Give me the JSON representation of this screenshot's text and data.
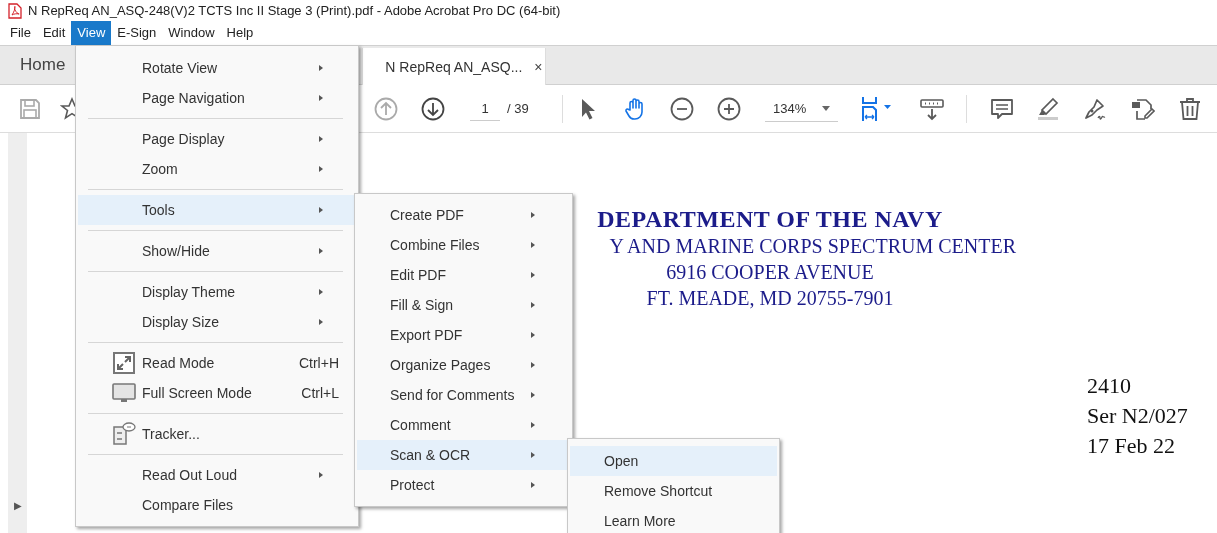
{
  "window": {
    "title": "N RepReq AN_ASQ-248(V)2 TCTS Inc II Stage 3 (Print).pdf - Adobe Acrobat Pro DC (64-bit)"
  },
  "menu_bar": [
    {
      "label": "File",
      "selected": false
    },
    {
      "label": "Edit",
      "selected": false
    },
    {
      "label": "View",
      "selected": true
    },
    {
      "label": "E-Sign",
      "selected": false
    },
    {
      "label": "Window",
      "selected": false
    },
    {
      "label": "Help",
      "selected": false
    }
  ],
  "tabs": [
    {
      "label": "Home",
      "selected": false
    },
    {
      "label": "N RepReq AN_ASQ...",
      "selected": true,
      "close": "×"
    }
  ],
  "toolbar": {
    "page": "1",
    "page_count": "/ 39",
    "zoom": "134%",
    "tools": [
      {
        "selected": false
      },
      {
        "selected": true
      }
    ]
  },
  "document": {
    "heading": "DEPARTMENT OF THE NAVY",
    "address": [
      "Y AND MARINE CORPS SPECTRUM CENTER",
      "6916 COOPER AVENUE",
      "FT. MEADE, MD 20755-7901"
    ],
    "reference": [
      "2410",
      "Ser N2/027",
      "17 Feb 22"
    ],
    "expander": "▶"
  },
  "view_menu": {
    "groups": [
      [
        {
          "label": "Rotate View",
          "submenu": true,
          "selected": false
        },
        {
          "label": "Page Navigation",
          "submenu": true,
          "selected": false
        }
      ],
      [
        {
          "label": "Page Display",
          "submenu": true,
          "selected": false
        },
        {
          "label": "Zoom",
          "submenu": true,
          "selected": false
        }
      ],
      [
        {
          "label": "Tools",
          "submenu": true,
          "selected": true
        }
      ],
      [
        {
          "label": "Show/Hide",
          "submenu": true,
          "selected": false
        }
      ],
      [
        {
          "label": "Display Theme",
          "submenu": true,
          "selected": false
        },
        {
          "label": "Display Size",
          "submenu": true,
          "selected": false
        }
      ],
      [
        {
          "label": "Read Mode",
          "shortcut": "Ctrl+H",
          "submenu": false,
          "selected": false
        },
        {
          "label": "Full Screen Mode",
          "shortcut": "Ctrl+L",
          "submenu": false,
          "selected": false
        }
      ],
      [
        {
          "label": "Tracker...",
          "submenu": false,
          "selected": false
        }
      ],
      [
        {
          "label": "Read Out Loud",
          "submenu": true,
          "selected": false
        },
        {
          "label": "Compare Files",
          "submenu": false,
          "selected": false
        }
      ]
    ]
  },
  "tools_menu": {
    "items": [
      {
        "label": "Create PDF",
        "submenu": true,
        "selected": false
      },
      {
        "label": "Combine Files",
        "submenu": true,
        "selected": false
      },
      {
        "label": "Edit PDF",
        "submenu": true,
        "selected": false
      },
      {
        "label": "Fill & Sign",
        "submenu": true,
        "selected": false
      },
      {
        "label": "Export PDF",
        "submenu": true,
        "selected": false
      },
      {
        "label": "Organize Pages",
        "submenu": true,
        "selected": false
      },
      {
        "label": "Send for Comments",
        "submenu": true,
        "selected": false
      },
      {
        "label": "Comment",
        "submenu": true,
        "selected": false
      },
      {
        "label": "Scan & OCR",
        "submenu": true,
        "selected": true
      },
      {
        "label": "Protect",
        "submenu": true,
        "selected": false
      }
    ]
  },
  "scan_menu": {
    "items": [
      {
        "label": "Open",
        "submenu": false,
        "selected": true
      },
      {
        "label": "Remove Shortcut",
        "submenu": false,
        "selected": false
      },
      {
        "label": "Learn More",
        "submenu": false,
        "selected": false
      }
    ]
  }
}
